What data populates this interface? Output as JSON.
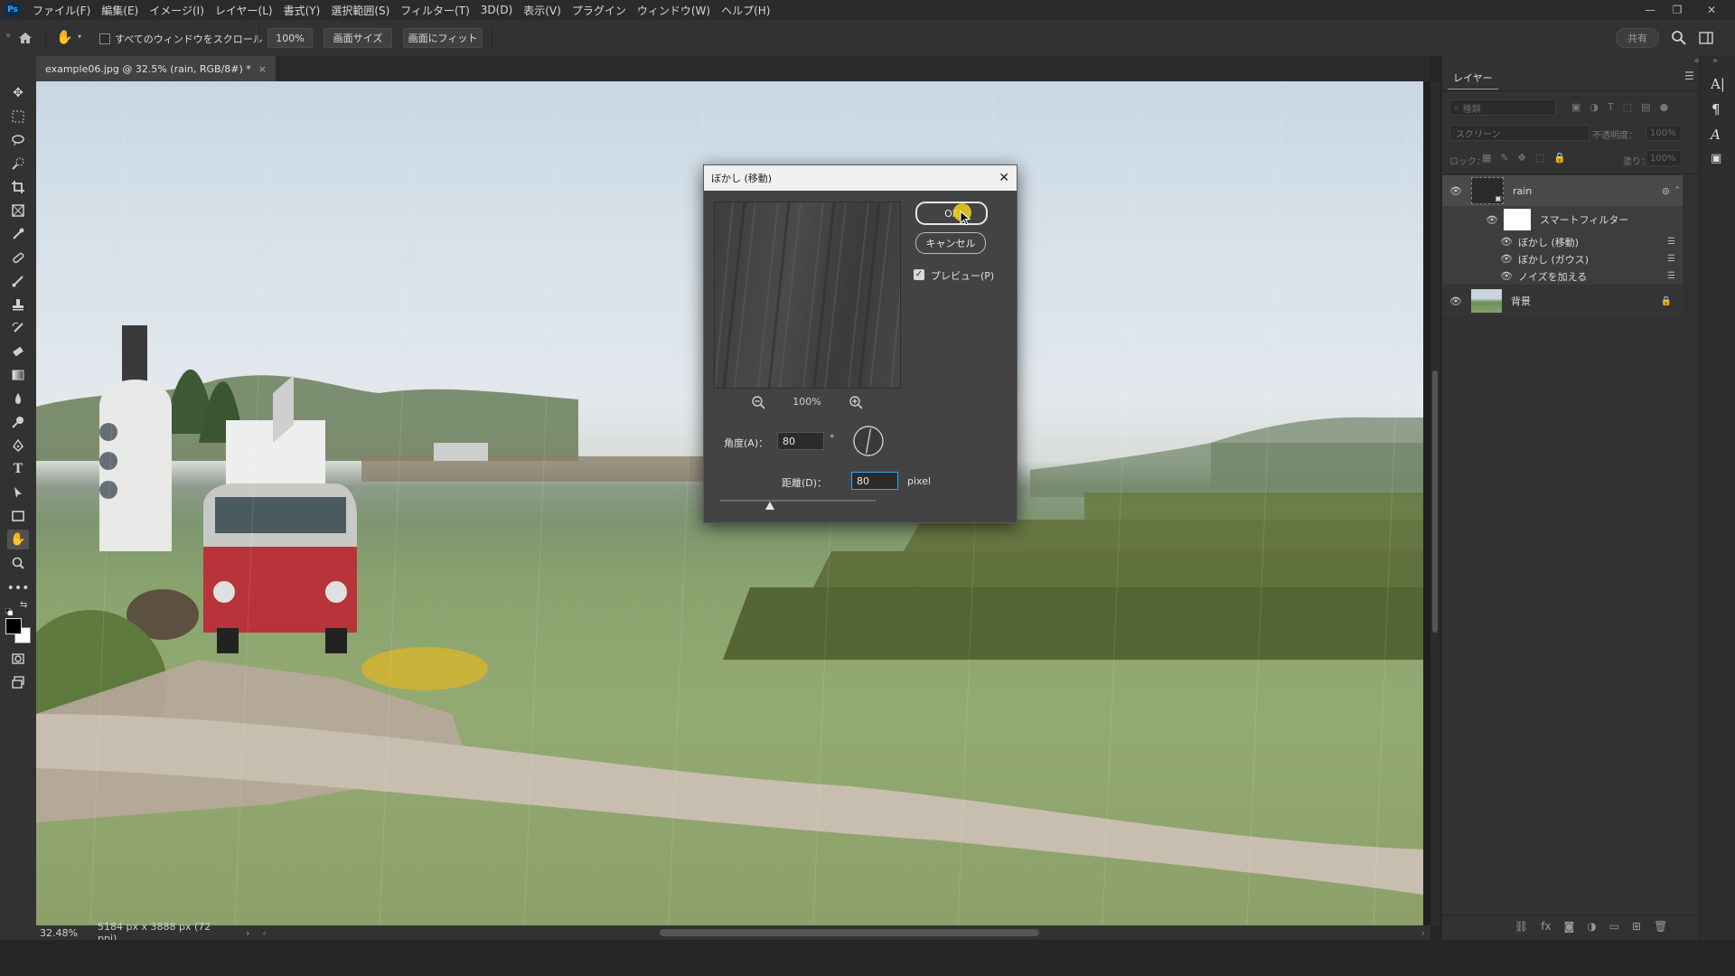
{
  "app": {
    "logo": "Ps"
  },
  "menu": [
    "ファイル(F)",
    "編集(E)",
    "イメージ(I)",
    "レイヤー(L)",
    "書式(Y)",
    "選択範囲(S)",
    "フィルター(T)",
    "3D(D)",
    "表示(V)",
    "プラグイン",
    "ウィンドウ(W)",
    "ヘルプ(H)"
  ],
  "window_controls": {
    "minimize": "—",
    "restore": "❐",
    "close": "✕"
  },
  "options": {
    "scroll_all_label": "すべてのウィンドウをスクロール",
    "scroll_all_checked": false,
    "zoom_value": "100%",
    "screen_size_label": "画面サイズ",
    "fit_screen_label": "画面にフィット",
    "share_label": "共有"
  },
  "document": {
    "tab_title": "example06.jpg @ 32.5% (rain, RGB/8#) *",
    "close_glyph": "×"
  },
  "status": {
    "zoom": "32.48%",
    "dimensions": "5184 px x 3888 px (72 ppi)"
  },
  "layers_panel": {
    "title": "レイヤー",
    "search_placeholder": "種類",
    "blend_mode": "スクリーン",
    "opacity_label": "不透明度：",
    "opacity_value": "100%",
    "lock_label": "ロック：",
    "fill_label": "塗り：",
    "fill_value": "100%",
    "layers": [
      {
        "name": "rain",
        "visible": true,
        "type": "smart-object"
      },
      {
        "name": "スマートフィルター",
        "visible": true,
        "type": "smart-filter-group"
      },
      {
        "name": "ぼかし (移動)",
        "visible": true,
        "type": "filter"
      },
      {
        "name": "ぼかし (ガウス)",
        "visible": true,
        "type": "filter"
      },
      {
        "name": "ノイズを加える",
        "visible": true,
        "type": "filter"
      },
      {
        "name": "背景",
        "visible": true,
        "type": "background",
        "locked": true
      }
    ]
  },
  "dialog": {
    "title": "ぼかし (移動)",
    "ok_label": "OK",
    "cancel_label": "キャンセル",
    "preview_label": "プレビュー(P)",
    "preview_checked": true,
    "zoom_level": "100%",
    "angle_label": "角度(A)：",
    "angle_value": "80",
    "angle_unit": "°",
    "distance_label": "距離(D)：",
    "distance_value": "80",
    "distance_unit": "pixel",
    "distance_slider_fraction": 0.32
  },
  "colors": {
    "accent": "#31a8ff",
    "cursor_highlight": "#f2d21b",
    "panel_bg": "#323232",
    "dialog_bg": "#434343"
  }
}
